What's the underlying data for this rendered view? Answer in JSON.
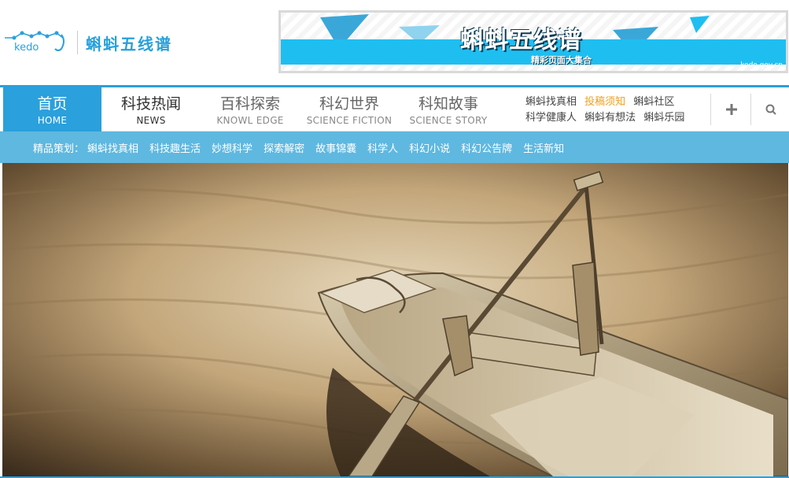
{
  "logo": {
    "text": "kedo",
    "name": "蝌蚪五线谱"
  },
  "banner": {
    "title": "蝌蚪五线谱",
    "subtitle": "精彩页面大集合",
    "url": "kedo.gov.cn"
  },
  "nav": {
    "items": [
      {
        "cn": "首页",
        "en": "HOME"
      },
      {
        "cn": "科技热闻",
        "en": "NEWS"
      },
      {
        "cn": "百科探索",
        "en": "KNOWL EDGE"
      },
      {
        "cn": "科幻世界",
        "en": "SCIENCE FICTION"
      },
      {
        "cn": "科知故事",
        "en": "SCIENCE STORY"
      }
    ],
    "quick_links_row1": [
      "蝌蚪找真相",
      "投稿须知",
      "蝌蚪社区"
    ],
    "quick_links_row2": [
      "科学健康人",
      "蝌蚪有想法",
      "蝌蚪乐园"
    ],
    "plus_icon": "plus-icon",
    "search_icon": "search-icon"
  },
  "subnav": {
    "label": "精品策划：",
    "items": [
      "蝌蚪找真相",
      "科技趣生活",
      "妙想科学",
      "探索解密",
      "故事锦囊",
      "科学人",
      "科幻小说",
      "科幻公告牌",
      "生活新知"
    ]
  },
  "colors": {
    "brand": "#2aa0dc",
    "subnav": "#5fb8e0",
    "highlight": "#f0a020"
  }
}
